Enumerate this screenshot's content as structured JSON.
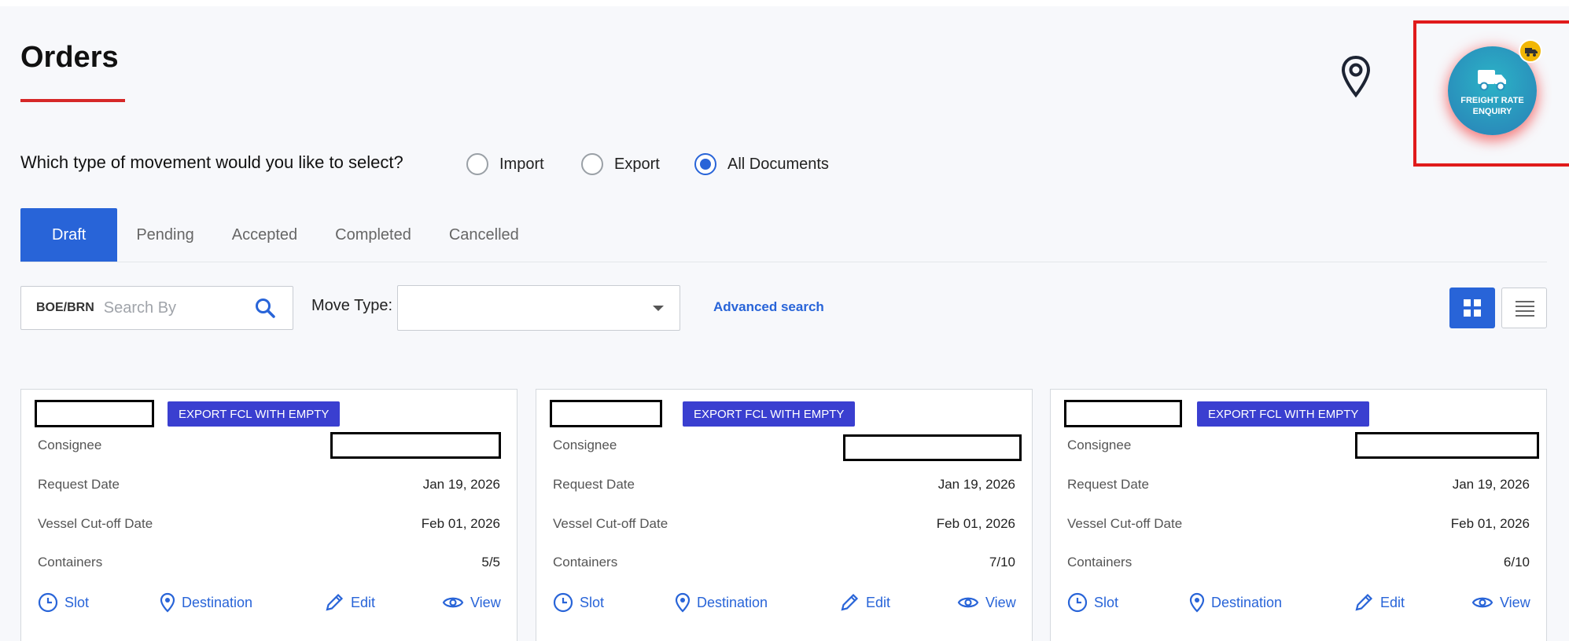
{
  "page": {
    "title": "Orders"
  },
  "fab": {
    "label": "FREIGHT RATE\nENQUIRY"
  },
  "movement": {
    "question": "Which type of movement would you like to select?",
    "options": [
      "Import",
      "Export",
      "All Documents"
    ],
    "selected": "All Documents"
  },
  "tabs": [
    "Draft",
    "Pending",
    "Accepted",
    "Completed",
    "Cancelled"
  ],
  "active_tab": "Draft",
  "search": {
    "prefix": "BOE/BRN",
    "placeholder": "Search By"
  },
  "move_type": {
    "label": "Move Type:",
    "value": ""
  },
  "advanced_search": "Advanced search",
  "card_labels": {
    "consignee": "Consignee",
    "request_date": "Request Date",
    "vessel_cutoff": "Vessel Cut-off Date",
    "containers": "Containers"
  },
  "actions": {
    "slot": "Slot",
    "destination": "Destination",
    "edit": "Edit",
    "view": "View"
  },
  "cards": [
    {
      "badge": "EXPORT FCL WITH EMPTY",
      "request_date": "Jan 19, 2026",
      "vessel_cutoff": "Feb 01, 2026",
      "containers": "5/5"
    },
    {
      "badge": "EXPORT FCL WITH EMPTY",
      "request_date": "Jan 19, 2026",
      "vessel_cutoff": "Feb 01, 2026",
      "containers": "7/10"
    },
    {
      "badge": "EXPORT FCL WITH EMPTY",
      "request_date": "Jan 19, 2026",
      "vessel_cutoff": "Feb 01, 2026",
      "containers": "6/10"
    }
  ],
  "colors": {
    "primary": "#2864d8",
    "badge": "#3a3fd0",
    "title_underline": "#d62828",
    "highlight": "#e01b1b",
    "fab": "#2a9fc0",
    "fab_badge": "#f2b705"
  }
}
